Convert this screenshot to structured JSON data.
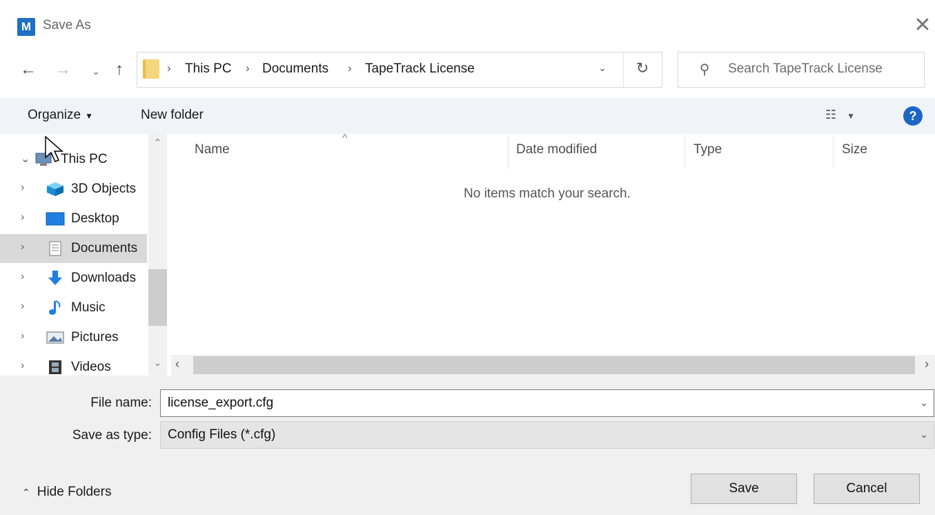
{
  "window": {
    "app_icon_letter": "M",
    "title": "Save As",
    "close_glyph": "✕"
  },
  "nav": {
    "back_icon": "arrow-left-icon",
    "forward_icon": "arrow-right-icon",
    "recent_icon": "chevron-down-icon",
    "up_icon": "arrow-up-icon"
  },
  "address": {
    "breadcrumbs": [
      "This PC",
      "Documents",
      "TapeTrack License"
    ],
    "separator": "›"
  },
  "search": {
    "placeholder": "Search TapeTrack License"
  },
  "toolbar": {
    "organize_label": "Organize",
    "new_folder_label": "New folder",
    "help_label": "?"
  },
  "tree": {
    "items": [
      {
        "label": "This PC",
        "icon": "computer-icon",
        "expanded": true
      },
      {
        "label": "3D Objects",
        "icon": "cube-icon"
      },
      {
        "label": "Desktop",
        "icon": "desktop-icon"
      },
      {
        "label": "Documents",
        "icon": "document-icon",
        "selected": true
      },
      {
        "label": "Downloads",
        "icon": "download-arrow-icon"
      },
      {
        "label": "Music",
        "icon": "music-note-icon"
      },
      {
        "label": "Pictures",
        "icon": "picture-icon"
      },
      {
        "label": "Videos",
        "icon": "film-icon"
      }
    ]
  },
  "filelist": {
    "columns": [
      "Name",
      "Date modified",
      "Type",
      "Size"
    ],
    "empty_message": "No items match your search."
  },
  "form": {
    "file_name_label": "File name:",
    "file_name_value": "license_export.cfg",
    "save_type_label": "Save as type:",
    "save_type_value": "Config Files (*.cfg)"
  },
  "footer": {
    "hide_folders_label": "Hide Folders",
    "save_label": "Save",
    "cancel_label": "Cancel"
  },
  "colors": {
    "accent": "#1e66c4",
    "selected_row": "#d9d9d9",
    "toolbar_bg": "#f0f4f9"
  }
}
